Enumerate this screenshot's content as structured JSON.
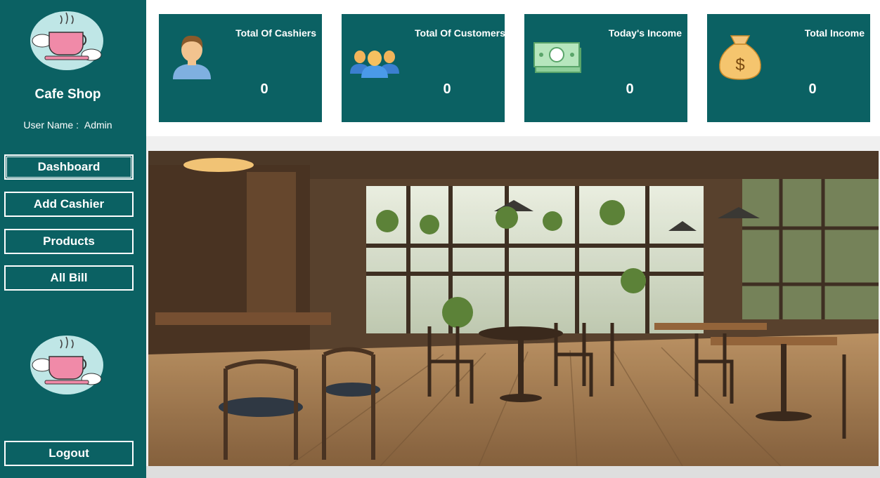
{
  "app": {
    "brand": "Cafe Shop",
    "user_label": "User Name :",
    "user_name": "Admin"
  },
  "sidebar": {
    "items": [
      {
        "label": "Dashboard"
      },
      {
        "label": "Add Cashier"
      },
      {
        "label": "Products"
      },
      {
        "label": "All Bill"
      }
    ],
    "logout": "Logout"
  },
  "stats": [
    {
      "title": "Total Of Cashiers",
      "value": "0",
      "icon": "cashier-person-icon"
    },
    {
      "title": "Total Of Customers",
      "value": "0",
      "icon": "customers-group-icon"
    },
    {
      "title": "Today's Income",
      "value": "0",
      "icon": "cash-bill-icon"
    },
    {
      "title": "Total Income",
      "value": "0",
      "icon": "money-bag-icon"
    }
  ],
  "colors": {
    "sidebar": "#0b6163",
    "card": "#0b6163",
    "content_bg": "#dedede"
  }
}
